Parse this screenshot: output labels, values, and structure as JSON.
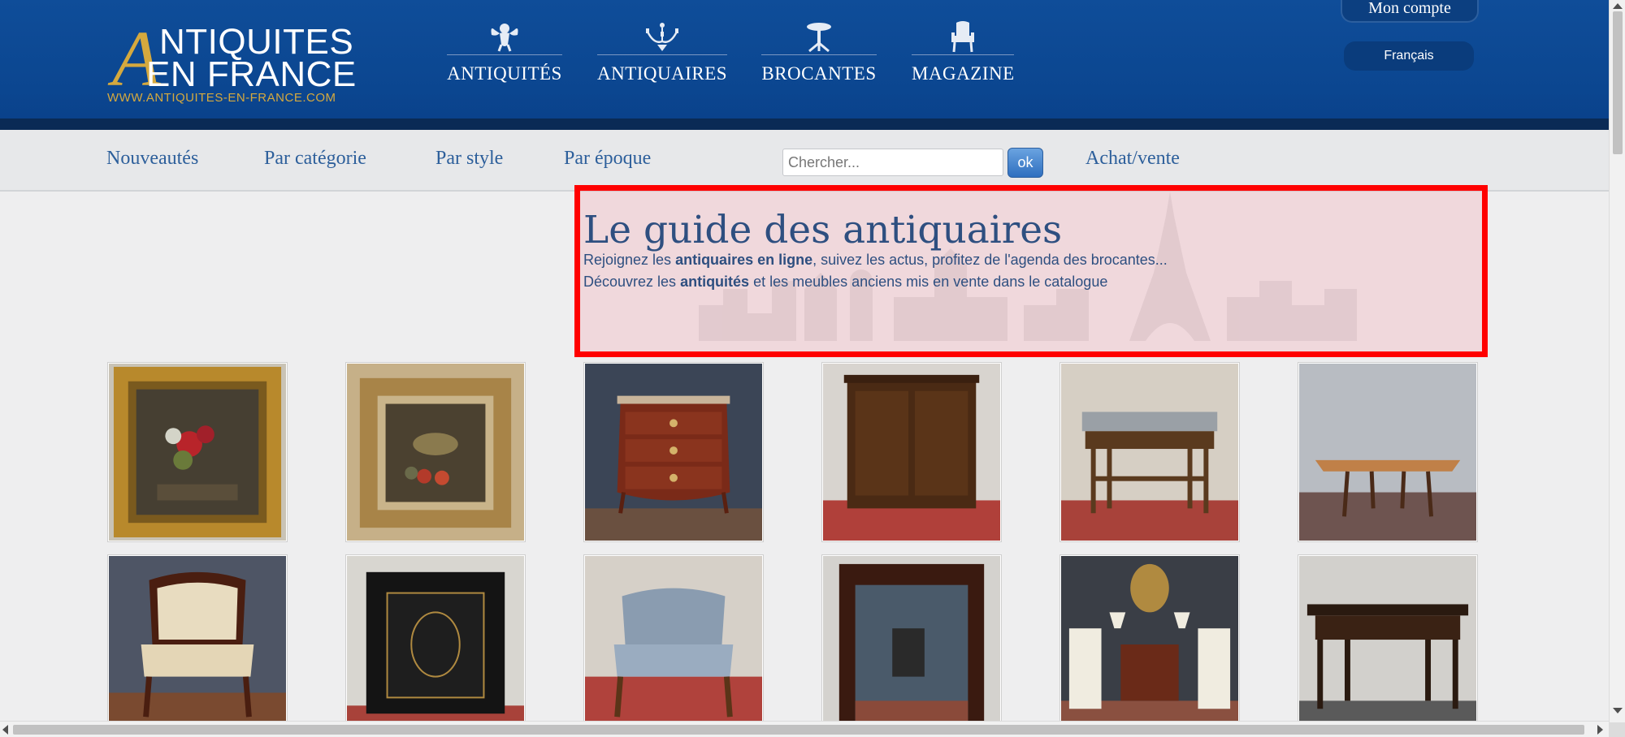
{
  "header": {
    "logo": {
      "big_letter": "A",
      "line1": "NTIQUITES",
      "line2": "EN FRANCE",
      "url": "WWW.ANTIQUITES-EN-FRANCE.COM"
    },
    "main_nav": [
      {
        "label": "ANTIQUITÉS",
        "icon": "cherub-icon"
      },
      {
        "label": "ANTIQUAIRES",
        "icon": "chandelier-icon"
      },
      {
        "label": "BROCANTES",
        "icon": "gueridon-table-icon"
      },
      {
        "label": "MAGAZINE",
        "icon": "armchair-icon"
      }
    ],
    "account_label": "Mon compte",
    "language_label": "Français"
  },
  "subnav": {
    "links": [
      "Nouveautés",
      "Par catégorie",
      "Par style",
      "Par époque"
    ],
    "search_placeholder": "Chercher...",
    "search_button": "ok",
    "buy_sell_link": "Achat/vente"
  },
  "hero": {
    "title": "Le guide des antiquaires",
    "line1": {
      "before": "Rejoignez les ",
      "bold": "antiquaires en ligne",
      "after": ", suivez les actus, profitez de l'agenda des brocantes..."
    },
    "line2": {
      "before": "Découvrez les ",
      "bold": "antiquités",
      "after": " et les meubles anciens mis en vente dans le catalogue"
    }
  },
  "products": [
    {
      "name": "gilt-framed-floral-painting"
    },
    {
      "name": "gilt-framed-still-life-painting"
    },
    {
      "name": "louis-xv-commode"
    },
    {
      "name": "wooden-cabinet"
    },
    {
      "name": "marble-top-washstand"
    },
    {
      "name": "drop-leaf-table"
    },
    {
      "name": "empire-armchair"
    },
    {
      "name": "napoleon-iii-black-cabinet"
    },
    {
      "name": "blue-striped-bergere"
    },
    {
      "name": "mahogany-mirror"
    },
    {
      "name": "bedside-table-with-chairs"
    },
    {
      "name": "dark-wood-console-table"
    }
  ],
  "colors": {
    "header_blue": "#0f4d99",
    "header_stripe": "#0a2a55",
    "logo_gold": "#d5a93e",
    "link_blue": "#2d5f9b",
    "hero_text": "#2e4f80",
    "highlight_red": "#ff0000"
  }
}
